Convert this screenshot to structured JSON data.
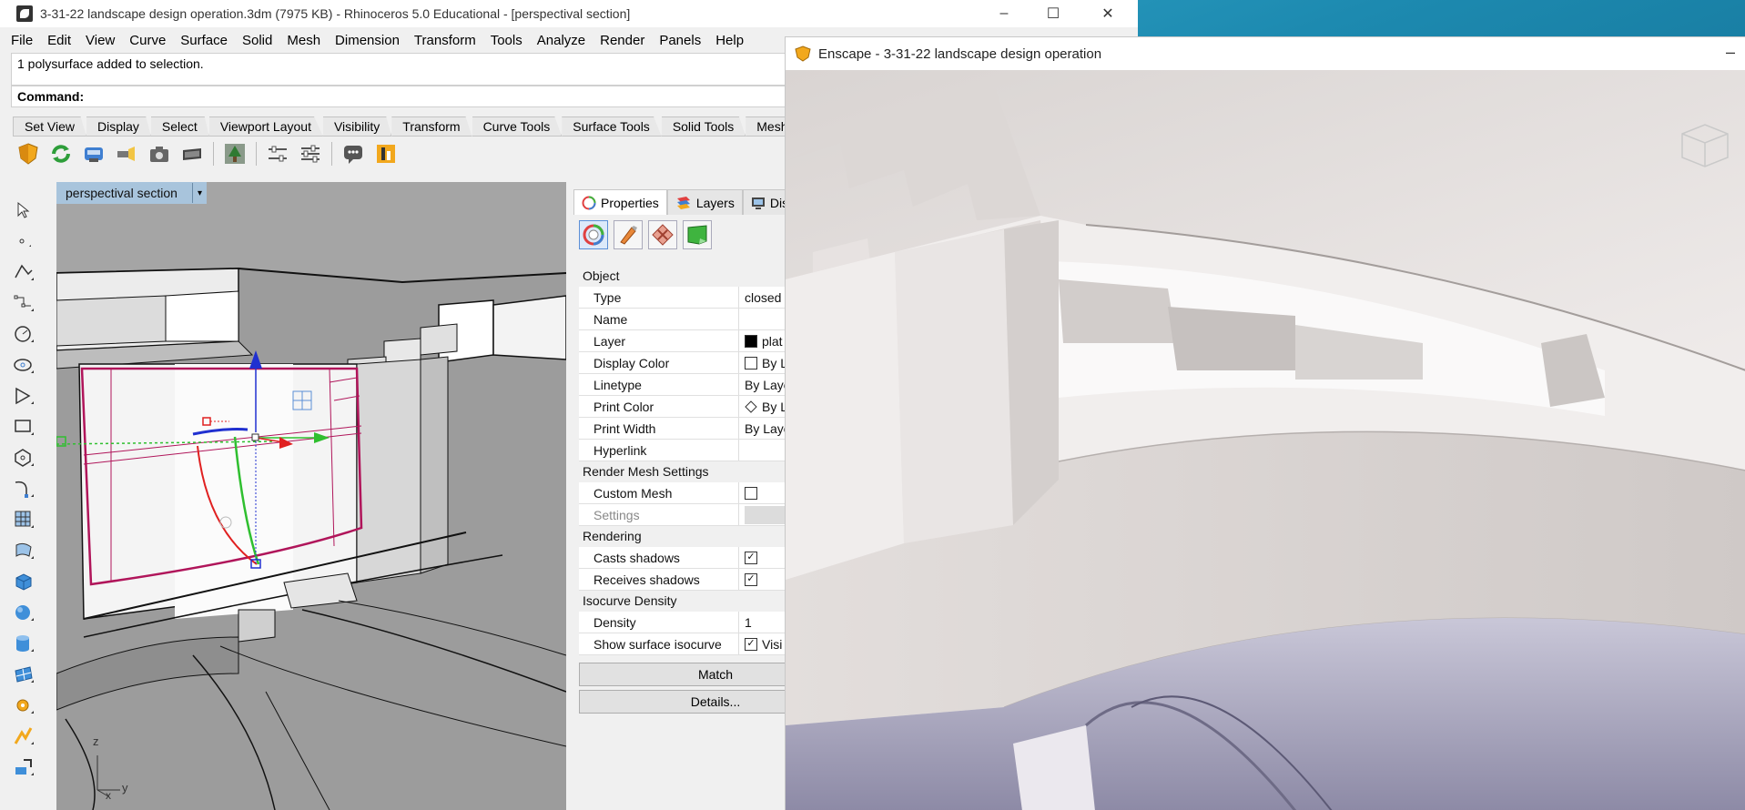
{
  "desktop": {
    "colors": {
      "sea_light": "#3fb6d8",
      "sea_dark": "#0e5778"
    }
  },
  "rhino": {
    "title": "3-31-22 landscape design operation.3dm (7975 KB) - Rhinoceros 5.0 Educational - [perspectival section]",
    "window_buttons": {
      "minimize": "–",
      "maximize": "☐",
      "close": "✕"
    },
    "menu": [
      "File",
      "Edit",
      "View",
      "Curve",
      "Surface",
      "Solid",
      "Mesh",
      "Dimension",
      "Transform",
      "Tools",
      "Analyze",
      "Render",
      "Panels",
      "Help"
    ],
    "command_history": "1 polysurface added to selection.",
    "command_prompt": "Command:",
    "toolbar_tabs": [
      "Set View",
      "Display",
      "Select",
      "Viewport Layout",
      "Visibility",
      "Transform",
      "Curve Tools",
      "Surface Tools",
      "Solid Tools",
      "Mesh Tools"
    ],
    "toolbar_icons": [
      "shield-icon",
      "refresh-icon",
      "render-icon",
      "flashlight-icon",
      "camera-icon",
      "vr-headset-icon",
      "tree-icon",
      "sliders-icon",
      "settings-sliders-icon",
      "chat-icon",
      "asset-library-icon"
    ],
    "palette_icons": [
      "select-arrow-icon",
      "point-icon",
      "polyline-icon",
      "curve-points-icon",
      "circle-icon",
      "ellipse-icon",
      "arc-icon",
      "rectangle-icon",
      "polygon-icon",
      "curve-edit-icon",
      "surface-grid-icon",
      "surface-edit-icon",
      "box-icon",
      "sphere-icon",
      "cylinder-icon",
      "mesh-icon",
      "gear-puzzle-icon",
      "analyze-icon",
      "transform-icon"
    ],
    "viewport": {
      "title": "perspectival section",
      "dropdown": "▾",
      "axis_z": "z",
      "axis_y": "y",
      "axis_x": "x"
    },
    "properties": {
      "tabs": [
        {
          "label": "Properties",
          "icon": "properties-icon",
          "active": true
        },
        {
          "label": "Layers",
          "icon": "layers-icon",
          "active": false
        },
        {
          "label": "Dis",
          "icon": "display-icon",
          "active": false
        }
      ],
      "page_icons": [
        "object-color-icon",
        "material-icon",
        "texture-map-icon",
        "decal-icon"
      ],
      "sections": [
        {
          "title": "Object",
          "rows": [
            {
              "key": "Type",
              "value": "closed"
            },
            {
              "key": "Name",
              "value": ""
            },
            {
              "key": "Layer",
              "value": "plat",
              "swatch": "#000000"
            },
            {
              "key": "Display Color",
              "value": "By L",
              "swatch": "#ffffff"
            },
            {
              "key": "Linetype",
              "value": "By Laye"
            },
            {
              "key": "Print Color",
              "value": "By L",
              "diamond": true
            },
            {
              "key": "Print Width",
              "value": "By Laye"
            },
            {
              "key": "Hyperlink",
              "value": ""
            }
          ]
        },
        {
          "title": "Render Mesh Settings",
          "rows": [
            {
              "key": "Custom Mesh",
              "checkbox": false
            },
            {
              "key": "Settings",
              "disabled": true
            }
          ]
        },
        {
          "title": "Rendering",
          "rows": [
            {
              "key": "Casts shadows",
              "checkbox": true
            },
            {
              "key": "Receives shadows",
              "checkbox": true
            }
          ]
        },
        {
          "title": "Isocurve Density",
          "rows": [
            {
              "key": "Density",
              "value": "1"
            },
            {
              "key": "Show surface isocurve",
              "checkbox": true,
              "value": "Visi"
            }
          ]
        }
      ],
      "buttons": {
        "match": "Match",
        "details": "Details..."
      }
    }
  },
  "enscape": {
    "title": "Enscape - 3-31-22 landscape design operation",
    "minimize": "–"
  }
}
